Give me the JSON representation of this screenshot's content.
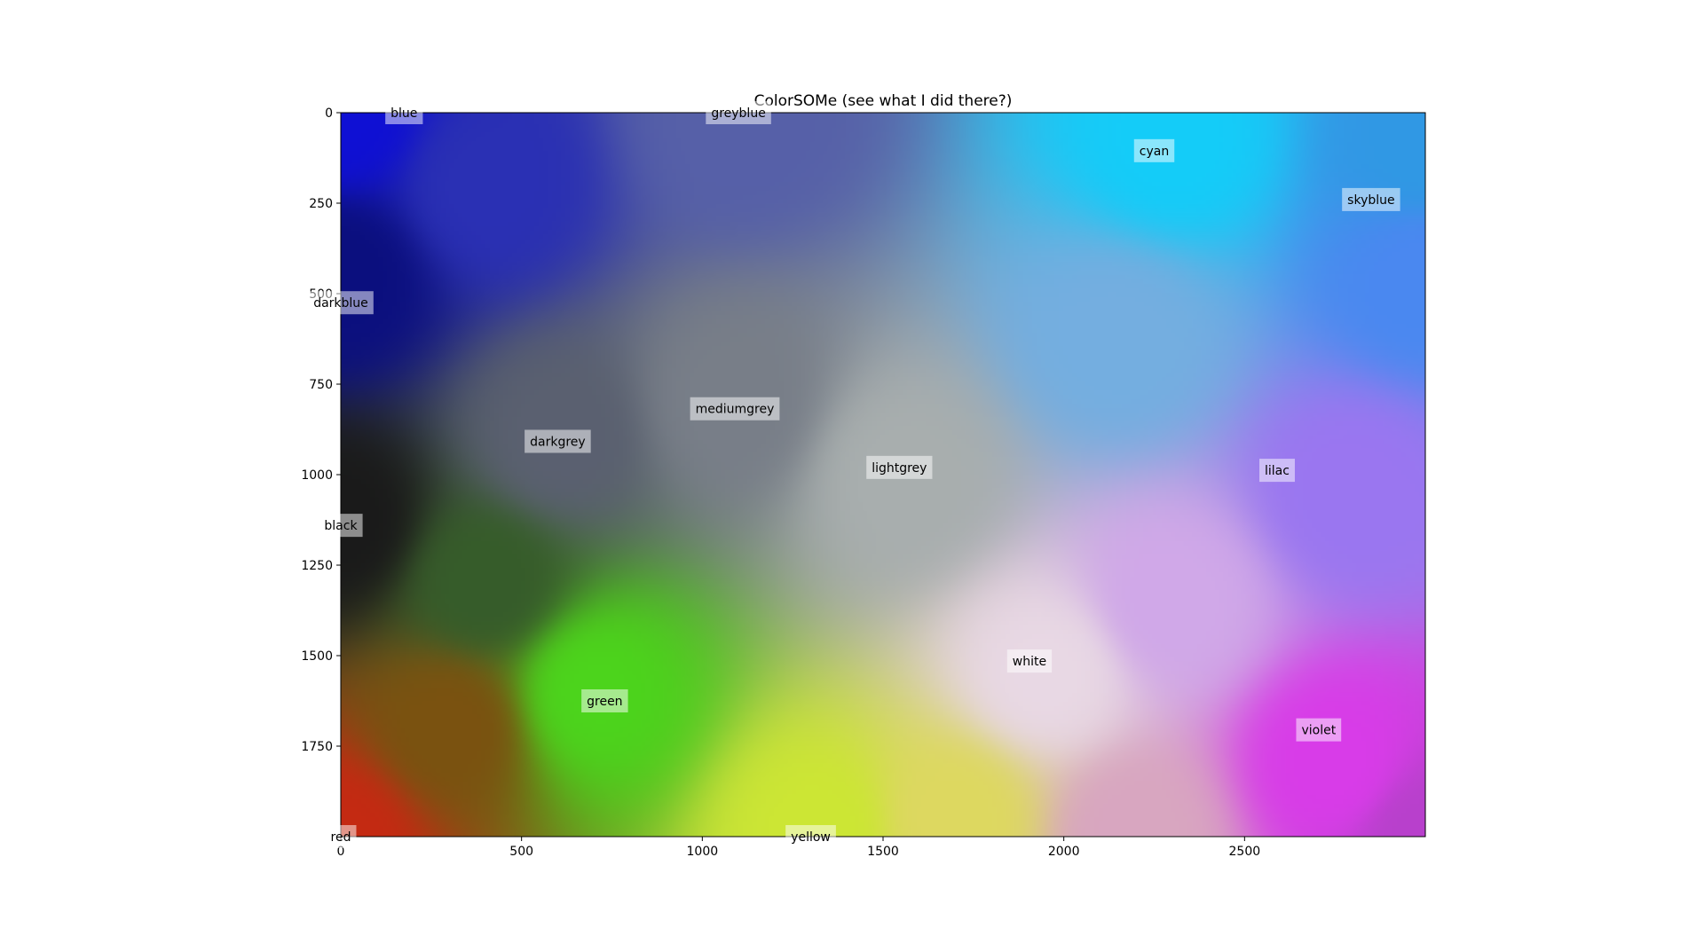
{
  "chart_data": {
    "type": "heatmap",
    "title": "ColorSOMe (see what I did there?)",
    "xlabel": "",
    "ylabel": "",
    "xlim": [
      0,
      3000
    ],
    "ylim": [
      2000,
      0
    ],
    "grid": false,
    "x_ticks": [
      0,
      500,
      1000,
      1500,
      2000,
      2500
    ],
    "y_ticks": [
      0,
      250,
      500,
      750,
      1000,
      1250,
      1500,
      1750
    ],
    "color_field": [
      {
        "x": 0,
        "y": 0,
        "color": "#0f10d4"
      },
      {
        "x": 0,
        "y": 450,
        "color": "#0b0f7e"
      },
      {
        "x": 0,
        "y": 1130,
        "color": "#1a1a1a"
      },
      {
        "x": 0,
        "y": 2000,
        "color": "#c42a12"
      },
      {
        "x": 1100,
        "y": 20,
        "color": "#5660a8"
      },
      {
        "x": 2300,
        "y": 80,
        "color": "#14ccf8"
      },
      {
        "x": 3000,
        "y": 100,
        "color": "#3098e4"
      },
      {
        "x": 3000,
        "y": 450,
        "color": "#4a88f0"
      },
      {
        "x": 2800,
        "y": 1050,
        "color": "#9a76f0"
      },
      {
        "x": 2750,
        "y": 1800,
        "color": "#d83ce8"
      },
      {
        "x": 3000,
        "y": 2000,
        "color": "#b840cc"
      },
      {
        "x": 1950,
        "y": 1550,
        "color": "#e8d8e4"
      },
      {
        "x": 1550,
        "y": 1000,
        "color": "#a8aeae"
      },
      {
        "x": 1080,
        "y": 800,
        "color": "#787e88"
      },
      {
        "x": 600,
        "y": 900,
        "color": "#5a6070"
      },
      {
        "x": 700,
        "y": 1600,
        "color": "#4cd41c"
      },
      {
        "x": 1320,
        "y": 1990,
        "color": "#cce634"
      },
      {
        "x": 1700,
        "y": 1950,
        "color": "#ddd860"
      },
      {
        "x": 300,
        "y": 1700,
        "color": "#7a5210"
      },
      {
        "x": 400,
        "y": 1300,
        "color": "#365c2a"
      },
      {
        "x": 2150,
        "y": 620,
        "color": "#74aee0"
      },
      {
        "x": 2300,
        "y": 1350,
        "color": "#d0a8e8"
      },
      {
        "x": 400,
        "y": 200,
        "color": "#2a30b4"
      },
      {
        "x": 2200,
        "y": 2000,
        "color": "#d8a6c0"
      }
    ],
    "annotations": [
      {
        "label": "blue",
        "x": 175,
        "y": 0
      },
      {
        "label": "greyblue",
        "x": 1100,
        "y": 0
      },
      {
        "label": "cyan",
        "x": 2250,
        "y": 105
      },
      {
        "label": "skyblue",
        "x": 2850,
        "y": 240
      },
      {
        "label": "darkblue",
        "x": 0,
        "y": 525
      },
      {
        "label": "mediumgrey",
        "x": 1090,
        "y": 818
      },
      {
        "label": "darkgrey",
        "x": 600,
        "y": 908
      },
      {
        "label": "lightgrey",
        "x": 1545,
        "y": 980
      },
      {
        "label": "lilac",
        "x": 2590,
        "y": 988
      },
      {
        "label": "black",
        "x": 0,
        "y": 1140
      },
      {
        "label": "white",
        "x": 1905,
        "y": 1515
      },
      {
        "label": "green",
        "x": 730,
        "y": 1625
      },
      {
        "label": "violet",
        "x": 2705,
        "y": 1705
      },
      {
        "label": "red",
        "x": 0,
        "y": 2000
      },
      {
        "label": "yellow",
        "x": 1300,
        "y": 2000
      }
    ]
  }
}
